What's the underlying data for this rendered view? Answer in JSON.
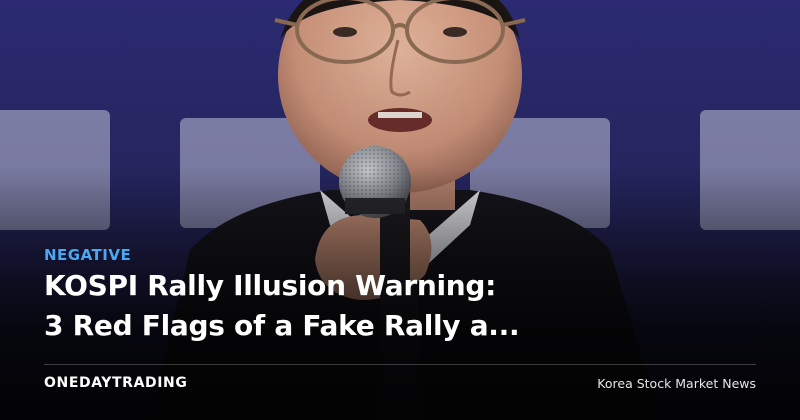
{
  "article": {
    "sentiment": "NEGATIVE",
    "headline_line1": "KOSPI Rally Illusion Warning:",
    "headline_line2": "3 Red Flags of a Fake Rally a..."
  },
  "footer": {
    "brand": "ONEDAYTRADING",
    "tagline": "Korea Stock Market News"
  },
  "colors": {
    "sentiment_accent": "#4aa8f2",
    "backdrop": "#2a2c6e",
    "text": "#ffffff"
  }
}
